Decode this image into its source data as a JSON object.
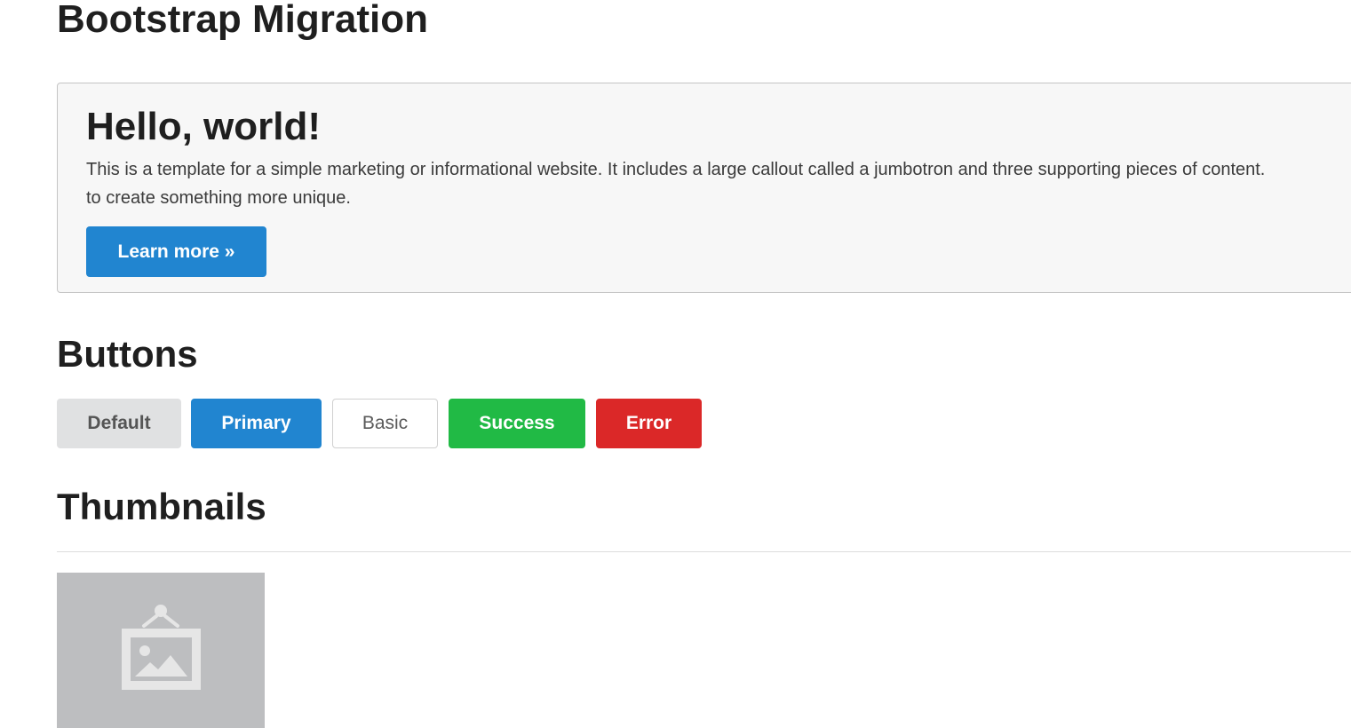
{
  "page": {
    "title": "Bootstrap Migration"
  },
  "jumbotron": {
    "heading": "Hello, world!",
    "text_line1": "This is a template for a simple marketing or informational website. It includes a large callout called a jumbotron and three supporting pieces of content.",
    "text_line2": "to create something more unique.",
    "button_label": "Learn more »",
    "button_color": "#2185d0"
  },
  "buttons_section": {
    "title": "Buttons",
    "buttons": [
      {
        "label": "Default",
        "color": "#e0e1e2"
      },
      {
        "label": "Primary",
        "color": "#2185d0"
      },
      {
        "label": "Basic",
        "color": "#ffffff"
      },
      {
        "label": "Success",
        "color": "#21ba45"
      },
      {
        "label": "Error",
        "color": "#db2828"
      }
    ]
  },
  "thumbnails_section": {
    "title": "Thumbnails",
    "items": [
      {
        "icon": "image-placeholder-icon",
        "color": "#bdbec0"
      }
    ]
  }
}
